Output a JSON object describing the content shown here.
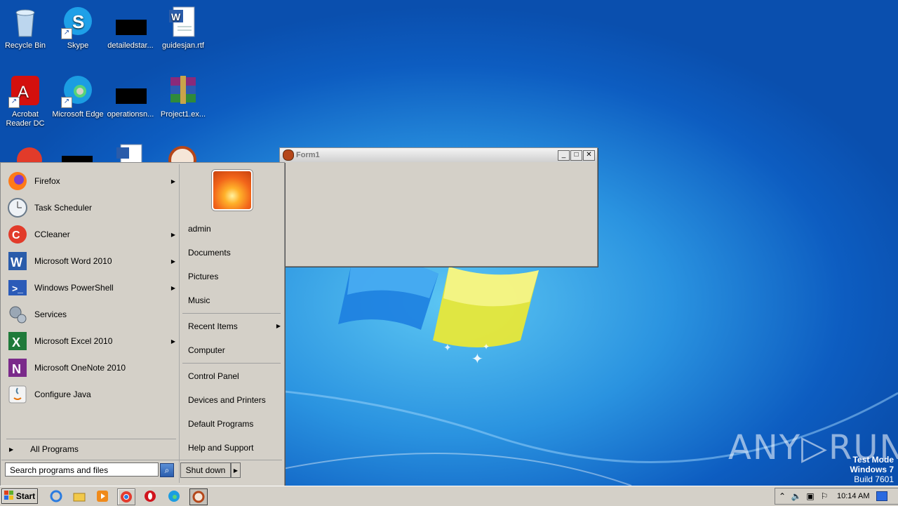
{
  "desktop": {
    "icons": [
      {
        "label": "Recycle Bin",
        "icon": "recycle-bin-icon"
      },
      {
        "label": "Skype",
        "icon": "skype-icon"
      },
      {
        "label": "detailedstar...",
        "icon": "file-thumbnail-icon"
      },
      {
        "label": "guidesjan.rtf",
        "icon": "word-document-icon"
      },
      {
        "label": "Acrobat Reader DC",
        "icon": "acrobat-icon"
      },
      {
        "label": "Microsoft Edge",
        "icon": "edge-icon"
      },
      {
        "label": "operationsn...",
        "icon": "file-thumbnail-icon"
      },
      {
        "label": "Project1.ex...",
        "icon": "winrar-icon"
      }
    ]
  },
  "form1": {
    "title": "Form1",
    "minimize": "_",
    "maximize": "□",
    "close": "✕"
  },
  "start_menu": {
    "programs": [
      {
        "label": "Firefox",
        "icon": "firefox-icon",
        "submenu": true
      },
      {
        "label": "Task Scheduler",
        "icon": "clock-icon",
        "submenu": false
      },
      {
        "label": "CCleaner",
        "icon": "ccleaner-icon",
        "submenu": true
      },
      {
        "label": "Microsoft Word 2010",
        "icon": "word-icon",
        "submenu": true
      },
      {
        "label": "Windows PowerShell",
        "icon": "powershell-icon",
        "submenu": true
      },
      {
        "label": "Services",
        "icon": "gears-icon",
        "submenu": false
      },
      {
        "label": "Microsoft Excel 2010",
        "icon": "excel-icon",
        "submenu": true
      },
      {
        "label": "Microsoft OneNote 2010",
        "icon": "onenote-icon",
        "submenu": false
      },
      {
        "label": "Configure Java",
        "icon": "java-icon",
        "submenu": false
      }
    ],
    "all_programs": "All Programs",
    "right_links": {
      "admin": "admin",
      "documents": "Documents",
      "pictures": "Pictures",
      "music": "Music",
      "recent_items": "Recent Items",
      "computer": "Computer",
      "control_panel": "Control Panel",
      "devices": "Devices and Printers",
      "default_programs": "Default Programs",
      "help": "Help and Support"
    },
    "search_placeholder": "Search programs and files",
    "shutdown": "Shut down"
  },
  "taskbar": {
    "start_label": "Start",
    "clock": "10:14 AM"
  },
  "watermark": {
    "brand": "ANY▷RUN",
    "test_mode": "Test Mode",
    "os": "Windows 7",
    "build": "Build 7601"
  }
}
